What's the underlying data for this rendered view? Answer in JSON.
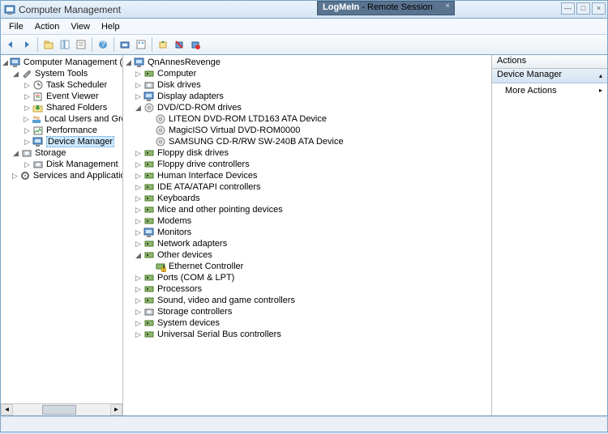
{
  "window": {
    "title": "Computer Management",
    "remote_app": "LogMeIn",
    "remote_suffix": " - Remote Session"
  },
  "menu": [
    "File",
    "Action",
    "View",
    "Help"
  ],
  "left_tree": {
    "root": "Computer Management (Local",
    "groups": [
      {
        "label": "System Tools",
        "items": [
          "Task Scheduler",
          "Event Viewer",
          "Shared Folders",
          "Local Users and Groups",
          "Performance",
          "Device Manager"
        ]
      },
      {
        "label": "Storage",
        "items": [
          "Disk Management"
        ]
      },
      {
        "label": "Services and Applications",
        "items": []
      }
    ]
  },
  "device_tree": {
    "root": "QnAnnesRevenge",
    "cats": [
      {
        "l": "Computer"
      },
      {
        "l": "Disk drives"
      },
      {
        "l": "Display adapters"
      },
      {
        "l": "DVD/CD-ROM drives",
        "open": true,
        "ch": [
          "LITEON DVD-ROM LTD163 ATA Device",
          "MagicISO Virtual DVD-ROM0000",
          "SAMSUNG CD-R/RW SW-240B ATA Device"
        ]
      },
      {
        "l": "Floppy disk drives"
      },
      {
        "l": "Floppy drive controllers"
      },
      {
        "l": "Human Interface Devices"
      },
      {
        "l": "IDE ATA/ATAPI controllers"
      },
      {
        "l": "Keyboards"
      },
      {
        "l": "Mice and other pointing devices"
      },
      {
        "l": "Modems"
      },
      {
        "l": "Monitors"
      },
      {
        "l": "Network adapters"
      },
      {
        "l": "Other devices",
        "open": true,
        "ch": [
          "Ethernet Controller"
        ],
        "warn": true
      },
      {
        "l": "Ports (COM & LPT)"
      },
      {
        "l": "Processors"
      },
      {
        "l": "Sound, video and game controllers"
      },
      {
        "l": "Storage controllers"
      },
      {
        "l": "System devices"
      },
      {
        "l": "Universal Serial Bus controllers"
      }
    ]
  },
  "actions": {
    "header": "Actions",
    "section": "Device Manager",
    "items": [
      "More Actions"
    ]
  },
  "toolbar_icons": [
    "back",
    "forward",
    "up",
    "show-hide",
    "export",
    "help",
    "sep",
    "view-large",
    "view-details",
    "sep",
    "refresh",
    "update",
    "uninstall"
  ],
  "colors": {
    "accent": "#cde8ff",
    "title": "#d4e4f4"
  }
}
